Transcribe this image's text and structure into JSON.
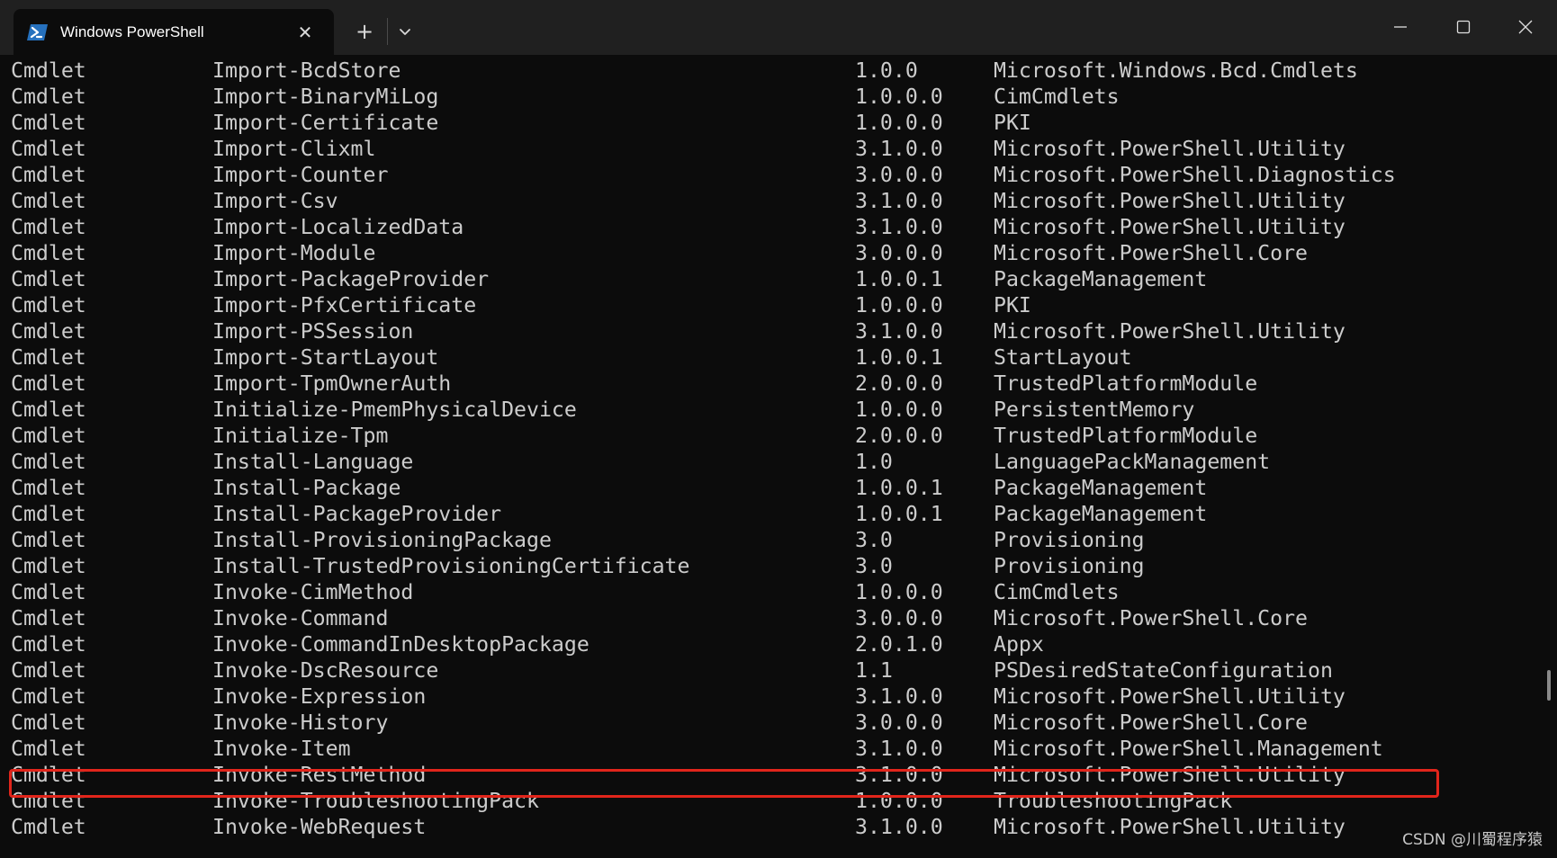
{
  "window": {
    "tab_title": "Windows PowerShell",
    "tab_icon": "powershell-icon",
    "close_tab_icon": "close-icon",
    "new_tab_icon": "plus-icon",
    "dropdown_icon": "chevron-down-icon",
    "minimize_icon": "minimize-icon",
    "maximize_icon": "maximize-icon",
    "close_window_icon": "close-icon"
  },
  "colors": {
    "terminal_background": "#0c0c0c",
    "titlebar_background": "#202020",
    "text": "#cccccc",
    "highlight_border": "#e1251b",
    "powershell_icon_blue": "#2671be"
  },
  "rows": [
    {
      "type": "Cmdlet",
      "name": "Import-BcdStore",
      "version": "1.0.0",
      "source": "Microsoft.Windows.Bcd.Cmdlets"
    },
    {
      "type": "Cmdlet",
      "name": "Import-BinaryMiLog",
      "version": "1.0.0.0",
      "source": "CimCmdlets"
    },
    {
      "type": "Cmdlet",
      "name": "Import-Certificate",
      "version": "1.0.0.0",
      "source": "PKI"
    },
    {
      "type": "Cmdlet",
      "name": "Import-Clixml",
      "version": "3.1.0.0",
      "source": "Microsoft.PowerShell.Utility"
    },
    {
      "type": "Cmdlet",
      "name": "Import-Counter",
      "version": "3.0.0.0",
      "source": "Microsoft.PowerShell.Diagnostics"
    },
    {
      "type": "Cmdlet",
      "name": "Import-Csv",
      "version": "3.1.0.0",
      "source": "Microsoft.PowerShell.Utility"
    },
    {
      "type": "Cmdlet",
      "name": "Import-LocalizedData",
      "version": "3.1.0.0",
      "source": "Microsoft.PowerShell.Utility"
    },
    {
      "type": "Cmdlet",
      "name": "Import-Module",
      "version": "3.0.0.0",
      "source": "Microsoft.PowerShell.Core"
    },
    {
      "type": "Cmdlet",
      "name": "Import-PackageProvider",
      "version": "1.0.0.1",
      "source": "PackageManagement"
    },
    {
      "type": "Cmdlet",
      "name": "Import-PfxCertificate",
      "version": "1.0.0.0",
      "source": "PKI"
    },
    {
      "type": "Cmdlet",
      "name": "Import-PSSession",
      "version": "3.1.0.0",
      "source": "Microsoft.PowerShell.Utility"
    },
    {
      "type": "Cmdlet",
      "name": "Import-StartLayout",
      "version": "1.0.0.1",
      "source": "StartLayout"
    },
    {
      "type": "Cmdlet",
      "name": "Import-TpmOwnerAuth",
      "version": "2.0.0.0",
      "source": "TrustedPlatformModule"
    },
    {
      "type": "Cmdlet",
      "name": "Initialize-PmemPhysicalDevice",
      "version": "1.0.0.0",
      "source": "PersistentMemory"
    },
    {
      "type": "Cmdlet",
      "name": "Initialize-Tpm",
      "version": "2.0.0.0",
      "source": "TrustedPlatformModule"
    },
    {
      "type": "Cmdlet",
      "name": "Install-Language",
      "version": "1.0",
      "source": "LanguagePackManagement"
    },
    {
      "type": "Cmdlet",
      "name": "Install-Package",
      "version": "1.0.0.1",
      "source": "PackageManagement"
    },
    {
      "type": "Cmdlet",
      "name": "Install-PackageProvider",
      "version": "1.0.0.1",
      "source": "PackageManagement"
    },
    {
      "type": "Cmdlet",
      "name": "Install-ProvisioningPackage",
      "version": "3.0",
      "source": "Provisioning"
    },
    {
      "type": "Cmdlet",
      "name": "Install-TrustedProvisioningCertificate",
      "version": "3.0",
      "source": "Provisioning"
    },
    {
      "type": "Cmdlet",
      "name": "Invoke-CimMethod",
      "version": "1.0.0.0",
      "source": "CimCmdlets"
    },
    {
      "type": "Cmdlet",
      "name": "Invoke-Command",
      "version": "3.0.0.0",
      "source": "Microsoft.PowerShell.Core"
    },
    {
      "type": "Cmdlet",
      "name": "Invoke-CommandInDesktopPackage",
      "version": "2.0.1.0",
      "source": "Appx"
    },
    {
      "type": "Cmdlet",
      "name": "Invoke-DscResource",
      "version": "1.1",
      "source": "PSDesiredStateConfiguration"
    },
    {
      "type": "Cmdlet",
      "name": "Invoke-Expression",
      "version": "3.1.0.0",
      "source": "Microsoft.PowerShell.Utility"
    },
    {
      "type": "Cmdlet",
      "name": "Invoke-History",
      "version": "3.0.0.0",
      "source": "Microsoft.PowerShell.Core"
    },
    {
      "type": "Cmdlet",
      "name": "Invoke-Item",
      "version": "3.1.0.0",
      "source": "Microsoft.PowerShell.Management"
    },
    {
      "type": "Cmdlet",
      "name": "Invoke-RestMethod",
      "version": "3.1.0.0",
      "source": "Microsoft.PowerShell.Utility"
    },
    {
      "type": "Cmdlet",
      "name": "Invoke-TroubleshootingPack",
      "version": "1.0.0.0",
      "source": "TroubleshootingPack"
    },
    {
      "type": "Cmdlet",
      "name": "Invoke-WebRequest",
      "version": "3.1.0.0",
      "source": "Microsoft.PowerShell.Utility"
    }
  ],
  "watermark": "CSDN @川蜀程序猿"
}
